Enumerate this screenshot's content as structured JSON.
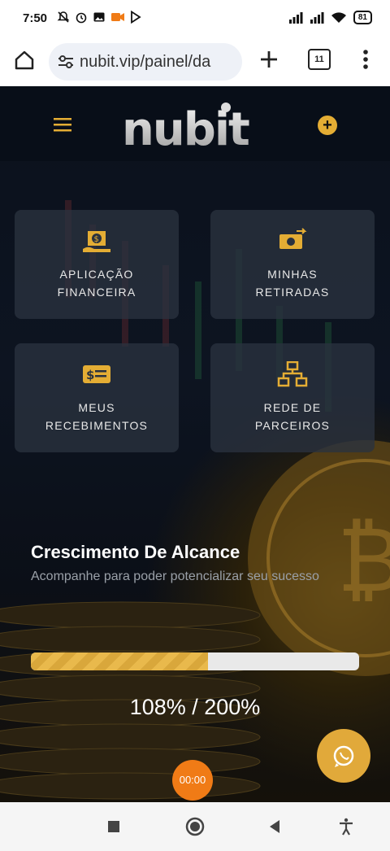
{
  "status_bar": {
    "time": "7:50",
    "battery": "81"
  },
  "browser": {
    "url": "nubit.vip/painel/da",
    "tab_count": "11"
  },
  "app": {
    "logo_text": "nubit",
    "cards": [
      {
        "label": "APLICAÇÃO\nFINANCEIRA",
        "icon": "money-bag-icon"
      },
      {
        "label": "MINHAS\nRETIRADAS",
        "icon": "cash-transfer-icon"
      },
      {
        "label": "MEUS\nRECEBIMENTOS",
        "icon": "bill-icon"
      },
      {
        "label": "REDE DE\nPARCEIROS",
        "icon": "network-icon"
      }
    ],
    "growth": {
      "title": "Crescimento De Alcance",
      "subtitle": "Acompanhe para poder potencializar seu sucesso",
      "progress_text": "108% / 200%",
      "progress_fraction": 0.54
    },
    "recording_timer": "00:00"
  },
  "colors": {
    "accent": "#e4ad34",
    "card_bg": "#2a323f",
    "record": "#f07b16"
  }
}
